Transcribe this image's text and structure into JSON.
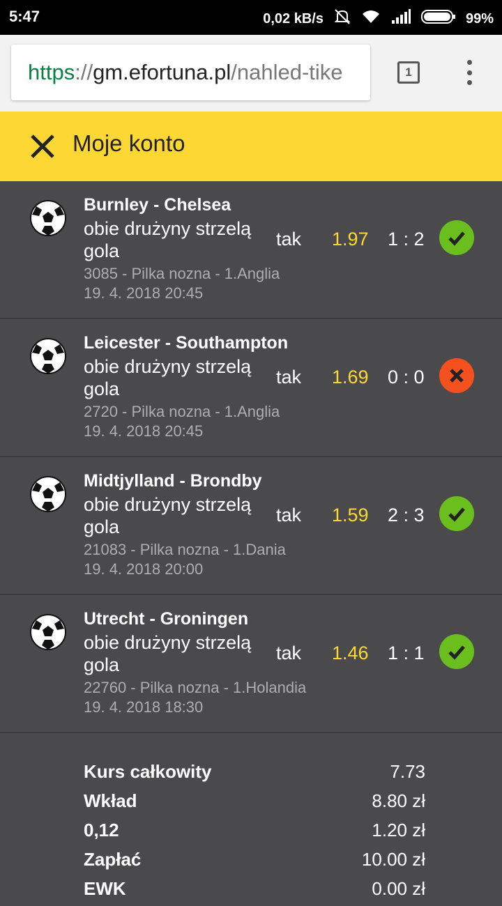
{
  "status_bar": {
    "time": "5:47",
    "network_speed": "0,02 kB/s",
    "battery": "99%"
  },
  "browser": {
    "url_scheme": "https",
    "url_separator": "://",
    "url_host": "gm.efortuna.pl",
    "url_path": "/nahled-tike",
    "tab_count": "1"
  },
  "header": {
    "title": "Moje konto"
  },
  "bets": [
    {
      "match": "Burnley - Chelsea",
      "market": "obie drużyny strzelą gola",
      "pick": "tak",
      "odds": "1.97",
      "score": "1 : 2",
      "result": "won",
      "info": "3085 - Pilka nozna - 1.Anglia",
      "datetime": "19. 4. 2018 20:45"
    },
    {
      "match": "Leicester - Southampton",
      "market": "obie drużyny strzelą gola",
      "pick": "tak",
      "odds": "1.69",
      "score": "0 : 0",
      "result": "lost",
      "info": "2720 - Pilka nozna - 1.Anglia",
      "datetime": "19. 4. 2018 20:45"
    },
    {
      "match": "Midtjylland - Brondby",
      "market": "obie drużyny strzelą gola",
      "pick": "tak",
      "odds": "1.59",
      "score": "2 : 3",
      "result": "won",
      "info": "21083 - Pilka nozna - 1.Dania",
      "datetime": "19. 4. 2018 20:00"
    },
    {
      "match": "Utrecht - Groningen",
      "market": "obie drużyny strzelą gola",
      "pick": "tak",
      "odds": "1.46",
      "score": "1 : 1",
      "result": "won",
      "info": "22760 - Pilka nozna - 1.Holandia",
      "datetime": "19. 4. 2018 18:30"
    }
  ],
  "summary": [
    {
      "label": "Kurs całkowity",
      "value": "7.73"
    },
    {
      "label": "Wkład",
      "value": "8.80 zł"
    },
    {
      "label": "0,12",
      "value": "1.20 zł"
    },
    {
      "label": "Zapłać",
      "value": "10.00 zł"
    },
    {
      "label": "EWK",
      "value": "0.00 zł"
    }
  ],
  "colors": {
    "accent": "#fdd835",
    "won": "#6abf1f",
    "lost": "#f4511e",
    "background": "#4a4a4c"
  }
}
